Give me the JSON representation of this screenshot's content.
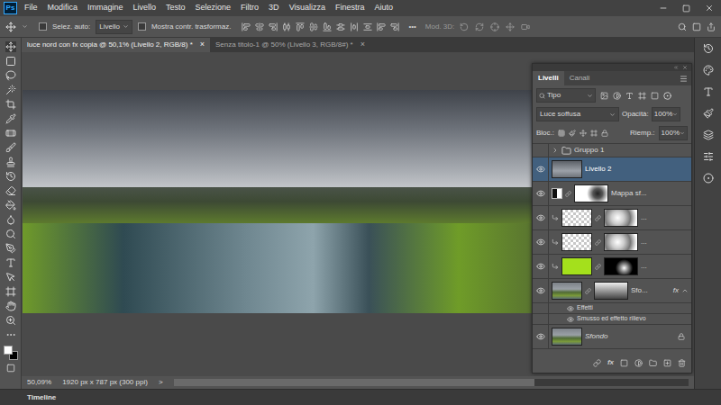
{
  "app": {
    "logo": "Ps"
  },
  "menu": [
    "File",
    "Modifica",
    "Immagine",
    "Livello",
    "Testo",
    "Selezione",
    "Filtro",
    "3D",
    "Visualizza",
    "Finestra",
    "Aiuto"
  ],
  "options_bar": {
    "auto_select": {
      "label": "Selez. auto:",
      "checked": false
    },
    "target": {
      "value": "Livello"
    },
    "transform_controls": {
      "label": "Mostra contr. trasformaz.",
      "checked": false
    },
    "more": "•••",
    "mode_3d": {
      "label": "Mod. 3D:"
    }
  },
  "documents": [
    {
      "title": "luce nord con fx copia @ 50,1% (Livello 2, RGB/8) *",
      "selected": true,
      "close": "×"
    },
    {
      "title": "Senza titolo-1 @ 50% (Livello 3, RGB/8#) *",
      "selected": false,
      "close": "×"
    }
  ],
  "layers_panel": {
    "tabs": [
      {
        "label": "Livelli",
        "selected": true
      },
      {
        "label": "Canali",
        "selected": false
      }
    ],
    "filter": "Tipo",
    "blend_mode": "Luce soffusa",
    "opacity": {
      "label": "Opacità:",
      "value": "100%"
    },
    "lock": {
      "label": "Bloc.:"
    },
    "fill": {
      "label": "Riemp.:",
      "value": "100%"
    },
    "layers": [
      {
        "kind": "group",
        "name": "Gruppo 1",
        "visible": false,
        "selected": false,
        "expanded": false,
        "clipped": false,
        "thumb": "folder",
        "mask": "none",
        "fx": "",
        "locked": false,
        "effects": []
      },
      {
        "kind": "layer",
        "name": "Livello 2",
        "visible": true,
        "selected": true,
        "expanded": false,
        "clipped": false,
        "thumb": "clouds",
        "mask": "none",
        "fx": "",
        "locked": false,
        "effects": []
      },
      {
        "kind": "adjustment",
        "name": "Mappa sf...",
        "visible": true,
        "selected": false,
        "expanded": false,
        "clipped": false,
        "thumb": "gradient",
        "mask": "light",
        "fx": "",
        "locked": false,
        "effects": []
      },
      {
        "kind": "layer",
        "name": "...",
        "visible": true,
        "selected": false,
        "expanded": false,
        "clipped": true,
        "thumb": "transparent",
        "mask": "mixed",
        "fx": "",
        "locked": false,
        "effects": []
      },
      {
        "kind": "layer",
        "name": "...",
        "visible": true,
        "selected": false,
        "expanded": false,
        "clipped": true,
        "thumb": "transparent",
        "mask": "mixed",
        "fx": "",
        "locked": false,
        "effects": []
      },
      {
        "kind": "fill",
        "name": "...",
        "visible": true,
        "selected": false,
        "expanded": false,
        "clipped": true,
        "thumb": "fill",
        "color": "#a4e01c",
        "mask": "dark",
        "fx": "",
        "locked": false,
        "effects": []
      },
      {
        "kind": "layer",
        "name": "Sfo...",
        "visible": true,
        "selected": false,
        "expanded": true,
        "clipped": false,
        "thumb": "photo",
        "mask": "photo",
        "fx": "fx",
        "locked": false,
        "effects": [
          {
            "name": "Effetti",
            "visible": true
          },
          {
            "name": "Smusso ed effetto rilievo",
            "visible": true
          }
        ]
      },
      {
        "kind": "background",
        "name": "Sfondo",
        "visible": true,
        "selected": false,
        "expanded": false,
        "clipped": false,
        "thumb": "photo",
        "mask": "none",
        "fx": "",
        "locked": true,
        "effects": []
      }
    ],
    "footer": {
      "fx": "fx"
    }
  },
  "status_bar": {
    "zoom": "50,09%",
    "info": "1920 px x 787 px (300 ppi)",
    "arrow": ">"
  },
  "timeline": {
    "label": "Timeline"
  }
}
